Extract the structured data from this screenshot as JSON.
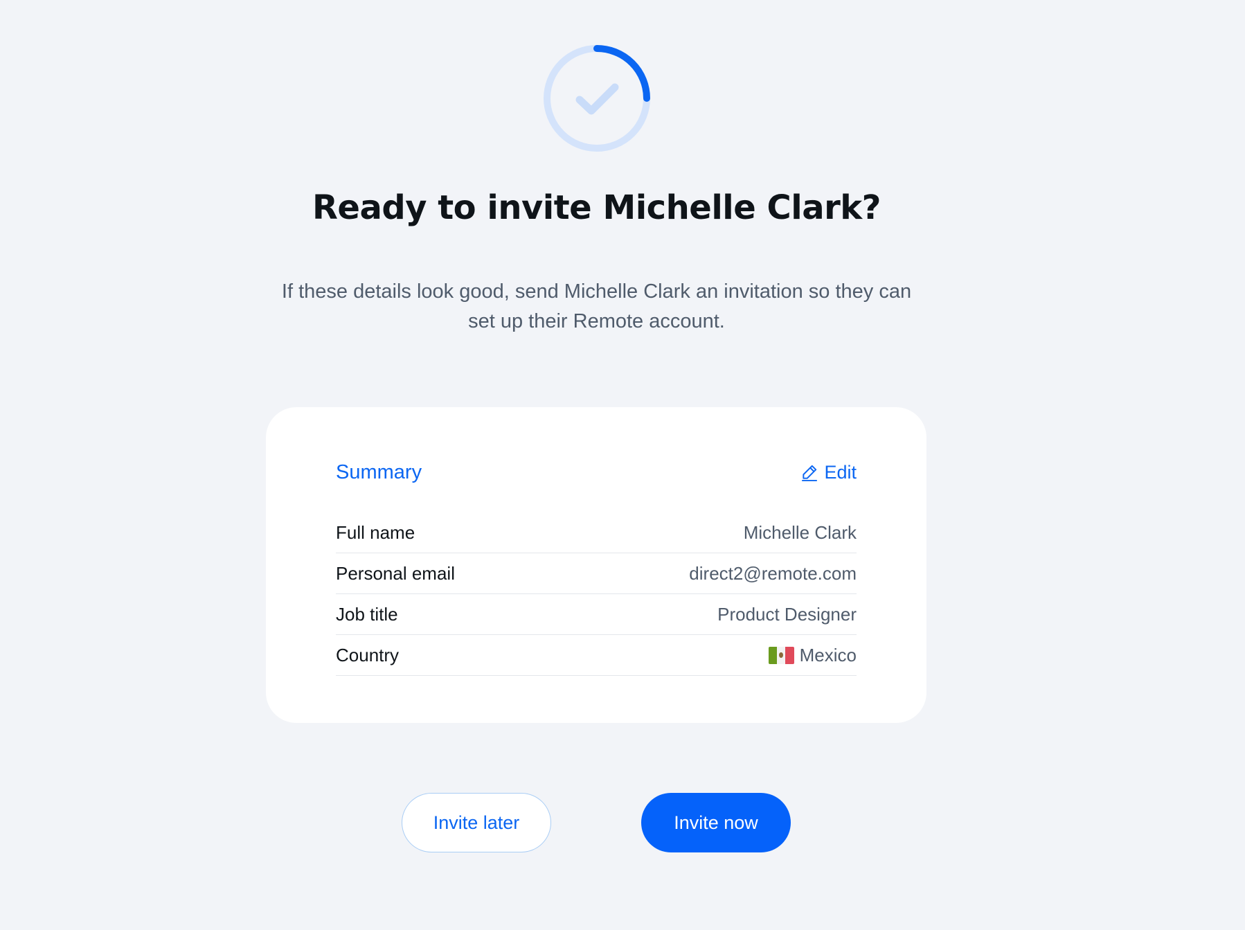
{
  "status_icon": {
    "icon": "check-icon",
    "progress": 0.25,
    "ring_color": "#d4e3fb",
    "arc_color": "#0b66f2"
  },
  "header": {
    "title": "Ready to invite Michelle Clark?",
    "subtitle": "If these details look good, send Michelle Clark an invitation so they can set up their Remote account."
  },
  "summary": {
    "title": "Summary",
    "edit_label": "Edit",
    "edit_icon": "pencil-icon",
    "rows": [
      {
        "label": "Full name",
        "value": "Michelle Clark"
      },
      {
        "label": "Personal email",
        "value": "direct2@remote.com"
      },
      {
        "label": "Job title",
        "value": "Product Designer"
      },
      {
        "label": "Country",
        "value": "Mexico",
        "icon": "mexico-flag-icon"
      }
    ]
  },
  "actions": {
    "invite_later_label": "Invite later",
    "invite_now_label": "Invite now"
  },
  "colors": {
    "accent": "#0b66f2",
    "background": "#f2f4f8",
    "primary_button": "#0562fa"
  }
}
